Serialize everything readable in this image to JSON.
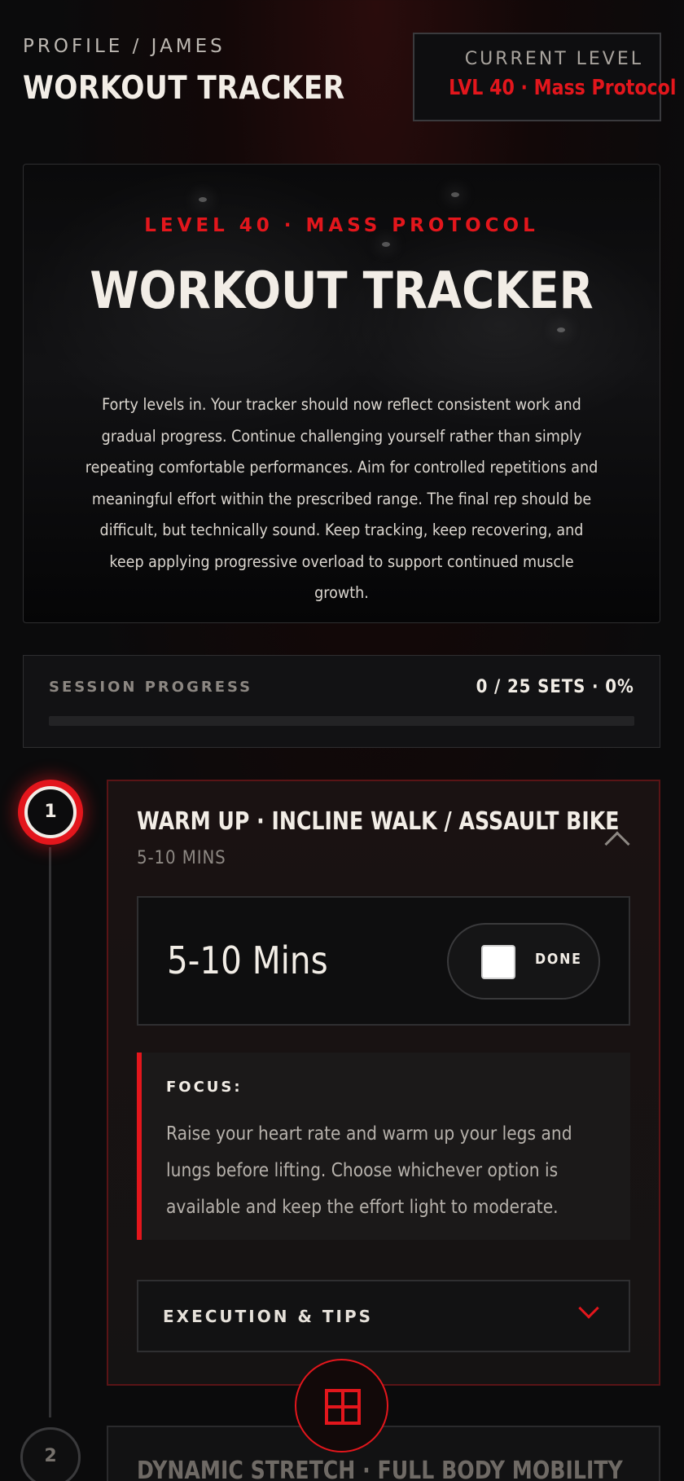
{
  "header": {
    "breadcrumb": "PROFILE / JAMES",
    "title": "WORKOUT TRACKER",
    "level_caption": "CURRENT LEVEL",
    "level_value": "LVL 40 · Mass Protocol"
  },
  "hero": {
    "eyebrow": "LEVEL 40 · MASS PROTOCOL",
    "title": "WORKOUT TRACKER",
    "body": "Forty levels in. Your tracker should now reflect consistent work and gradual progress. Continue challenging yourself rather than simply repeating comfortable performances. Aim for controlled repetitions and meaningful effort within the prescribed range. The final rep should be difficult, but technically sound. Keep tracking, keep recovering, and keep applying progressive overload to support continued muscle growth."
  },
  "progress": {
    "label": "SESSION PROGRESS",
    "stat": "0 / 25 SETS · 0%",
    "fraction": 0
  },
  "exercises": [
    {
      "number": "1",
      "title": "WARM UP · INCLINE WALK / ASSAULT BIKE",
      "subtitle": "5-10 MINS",
      "set_value": "5-10 Mins",
      "done_label": "DONE",
      "done_checked": false,
      "focus_label": "FOCUS:",
      "focus_text": "Raise your heart rate and warm up your legs and lungs before lifting. Choose whichever option is available and keep the effort light to moderate.",
      "exec_label": "EXECUTION & TIPS"
    },
    {
      "number": "2",
      "title": "DYNAMIC STRETCH · FULL BODY MOBILITY"
    }
  ],
  "colors": {
    "accent": "#e3161c",
    "background": "#0b0b0c",
    "text": "#f2ede6"
  },
  "icons": {
    "collapse": "chevron-up-icon",
    "expand": "chevron-down-icon",
    "fab": "grid-icon"
  }
}
